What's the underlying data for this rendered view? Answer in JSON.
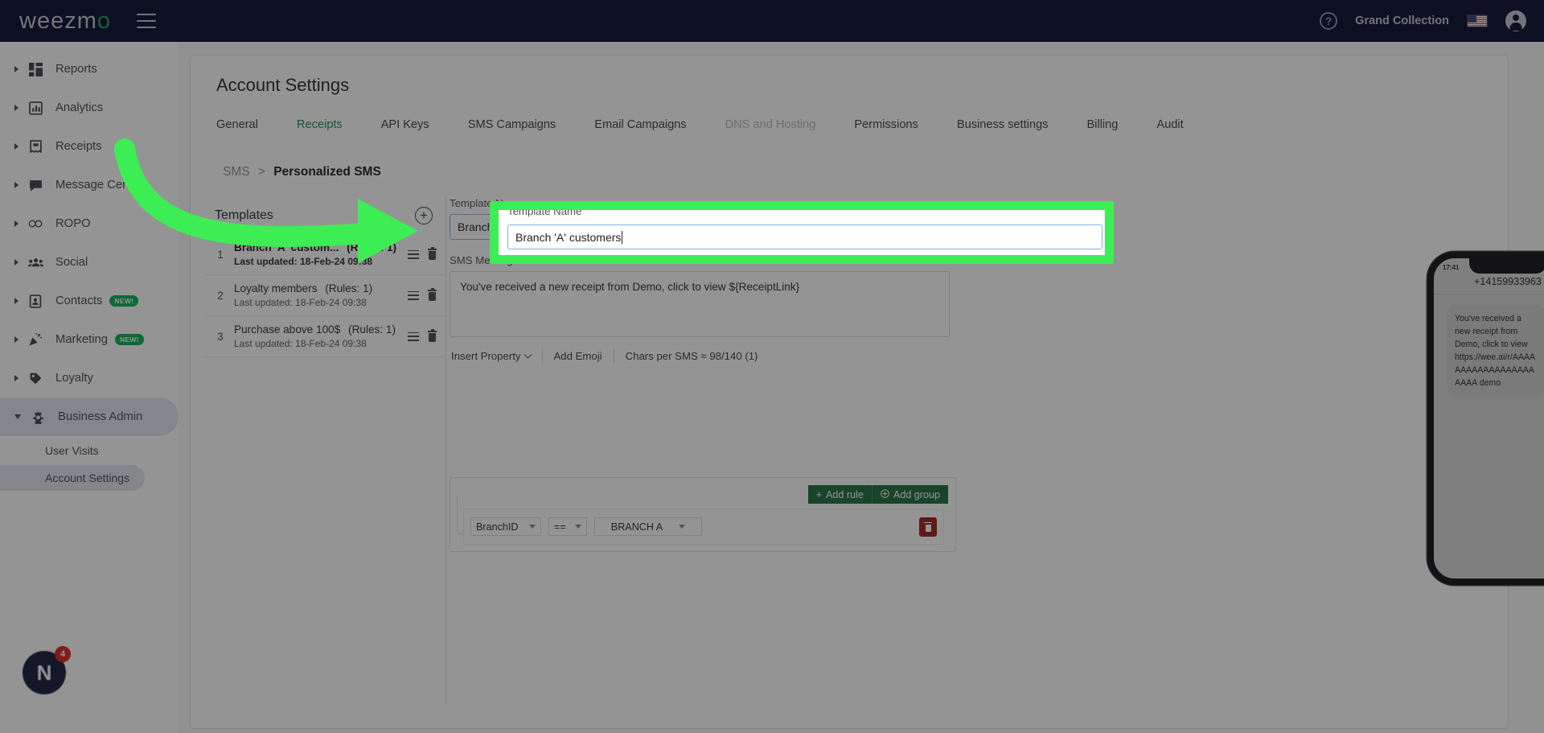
{
  "topbar": {
    "logo_main": "weezm",
    "logo_accent": "o",
    "menu_icon": "hamburger-icon",
    "help_icon": "?",
    "account_name": "Grand Collection",
    "flag": "us-flag",
    "avatar_icon": "user-avatar-icon"
  },
  "sidebar": {
    "items": [
      {
        "label": "Reports",
        "icon": "dashboard-icon",
        "badge": ""
      },
      {
        "label": "Analytics",
        "icon": "bar-chart-icon",
        "badge": ""
      },
      {
        "label": "Receipts",
        "icon": "receipt-icon",
        "badge": ""
      },
      {
        "label": "Message Center",
        "icon": "chat-bubble-icon",
        "badge": ""
      },
      {
        "label": "ROPO",
        "icon": "infinity-icon",
        "badge": ""
      },
      {
        "label": "Social",
        "icon": "people-icon",
        "badge": ""
      },
      {
        "label": "Contacts",
        "icon": "contact-card-icon",
        "badge": "NEW!"
      },
      {
        "label": "Marketing",
        "icon": "party-popper-icon",
        "badge": "NEW!"
      },
      {
        "label": "Loyalty",
        "icon": "tag-icon",
        "badge": ""
      },
      {
        "label": "Business Admin",
        "icon": "gear-icon",
        "badge": ""
      }
    ],
    "subitems": [
      {
        "label": "User Visits",
        "active": false
      },
      {
        "label": "Account Settings",
        "active": true
      }
    ],
    "notification_logo": "N",
    "notification_count": "4"
  },
  "page": {
    "title": "Account Settings",
    "tabs": [
      {
        "label": "General",
        "state": "normal"
      },
      {
        "label": "Receipts",
        "state": "active"
      },
      {
        "label": "API Keys",
        "state": "normal"
      },
      {
        "label": "SMS Campaigns",
        "state": "normal"
      },
      {
        "label": "Email Campaigns",
        "state": "normal"
      },
      {
        "label": "DNS and Hosting",
        "state": "disabled"
      },
      {
        "label": "Permissions",
        "state": "normal"
      },
      {
        "label": "Business settings",
        "state": "normal"
      },
      {
        "label": "Billing",
        "state": "normal"
      },
      {
        "label": "Audit",
        "state": "normal"
      }
    ],
    "breadcrumb": {
      "root": "SMS",
      "separator": ">",
      "current": "Personalized SMS"
    }
  },
  "templates": {
    "title": "Templates",
    "add_icon": "plus-circle-icon",
    "rows": [
      {
        "num": "1",
        "name": "Branch 'A' custom...",
        "rules": "(Rules: 1)",
        "updated": "Last updated: 18-Feb-24 09:38",
        "selected": true
      },
      {
        "num": "2",
        "name": "Loyalty members",
        "rules": "(Rules: 1)",
        "updated": "Last updated: 18-Feb-24 09:38",
        "selected": false
      },
      {
        "num": "3",
        "name": "Purchase above 100$",
        "rules": "(Rules: 1)",
        "updated": "Last updated: 18-Feb-24 09:38",
        "selected": false
      }
    ]
  },
  "editor": {
    "template_name_label": "Template Name",
    "template_name_value": "Branch 'A' customers",
    "sms_message_label": "SMS Message",
    "sms_message_required": "*",
    "sms_message_value": "You've received a new receipt from Demo, click to view ${ReceiptLink}",
    "toolbar": {
      "insert_property": "Insert Property",
      "add_emoji": "Add Emoji",
      "chars_per_sms": "Chars per SMS ≈ 98/140 (1)"
    }
  },
  "rules": {
    "add_rule": "Add rule",
    "add_group": "Add group",
    "add_rule_icon": "plus-icon",
    "add_group_icon": "plus-circle-icon",
    "delete_icon": "trash-icon",
    "row": {
      "field": "BranchID",
      "operator": "==",
      "value": "BRANCH A"
    }
  },
  "preview": {
    "status_time": "17:41",
    "phone_number": "+14159933963",
    "message": "You've received a new receipt from Demo, click to view https://wee.ai/r/AAAAAAAAAAAAAAAAAAAAAA demo"
  },
  "annotation": {
    "highlight_color": "#3ded54",
    "arrow_icon": "green-curved-arrow"
  }
}
